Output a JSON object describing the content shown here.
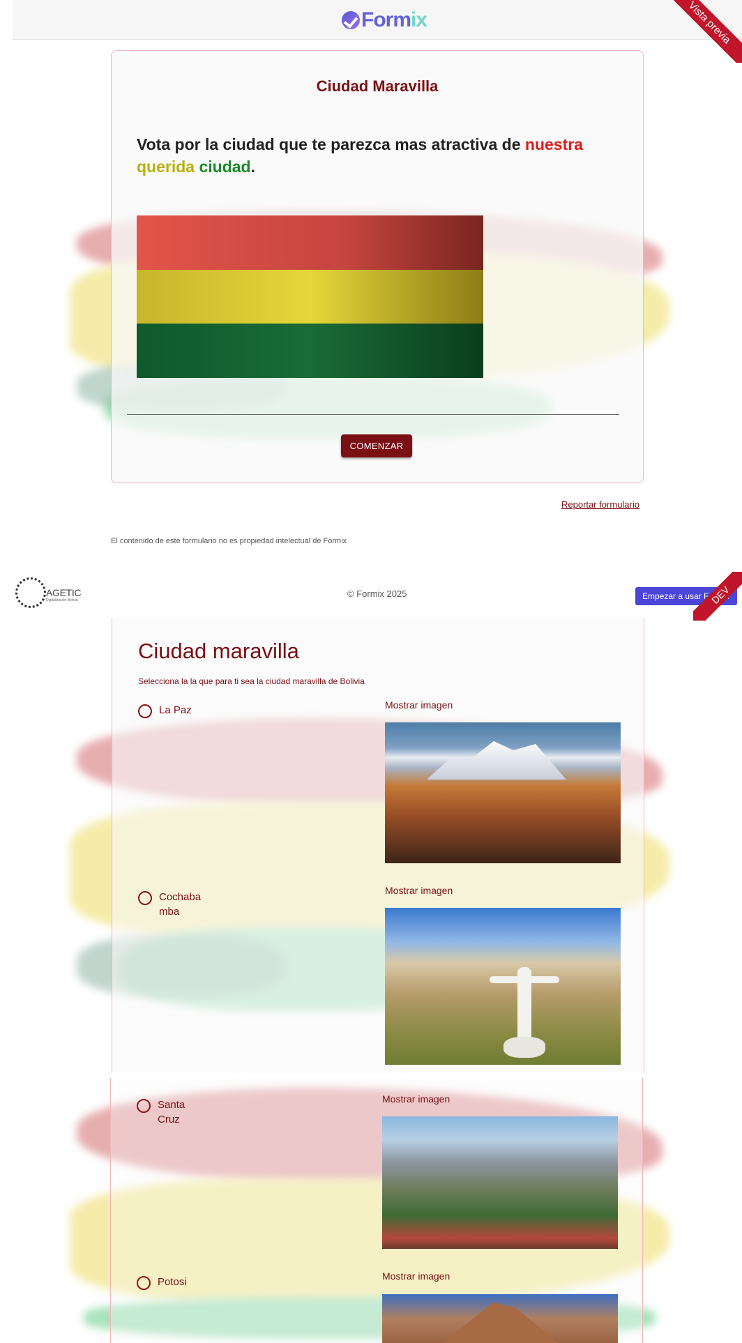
{
  "header": {
    "logo_text_a": "Form",
    "logo_text_b": "ix",
    "preview_ribbon": "Vista previa"
  },
  "intro": {
    "title": "Ciudad Maravilla",
    "desc_prefix": "Vota por la ciudad que te parezca mas atractiva de ",
    "desc_word1": "nuestra",
    "desc_word2": "querida",
    "desc_word3": "ciudad",
    "desc_suffix": ".",
    "start_button": "COMENZAR"
  },
  "links": {
    "report": "Reportar formulario",
    "disclaimer": "El contenido de este formulario no es propiedad intelectual de Formix"
  },
  "footer": {
    "agetic_name": "AGETIC",
    "agetic_sub": "Digitalización Bolivia",
    "copyright": "© Formix 2025",
    "start_formix": "Empezar a usar Formix",
    "dev_ribbon": "DEV"
  },
  "question": {
    "title": "Ciudad maravilla",
    "subtitle": "Selecciona la la que para ti sea la ciudad maravilla de Bolivia",
    "show_image_label": "Mostrar imagen",
    "options": [
      {
        "label": "La Paz"
      },
      {
        "label": "Cochabamba"
      },
      {
        "label": "Santa Cruz"
      },
      {
        "label": "Potosi"
      }
    ]
  },
  "colors": {
    "brand_dark_red": "#7a0f14",
    "formix_purple": "#4b46d8",
    "flag_red": "#d52b1e",
    "flag_yellow": "#f9e300",
    "flag_green": "#007934"
  }
}
